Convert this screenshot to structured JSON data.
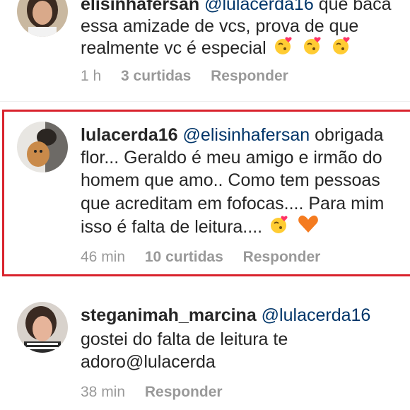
{
  "comments": [
    {
      "username": "elisinhafersan",
      "mention": "@lulacerda16",
      "lines": [
        "que baca",
        "essa amizade de vcs, prova de que",
        "realmente vc é especial"
      ],
      "time": "1 h",
      "likes": "3 curtidas",
      "reply": "Responder",
      "emojis": [
        "kiss-heart-emoji",
        "kiss-heart-emoji",
        "kiss-heart-emoji"
      ]
    },
    {
      "username": "lulacerda16",
      "mention": "@elisinhafersan",
      "lines": [
        "obrigada",
        "flor... Geraldo é meu amigo e irmão do",
        "homem que amo.. Como tem pessoas",
        "que acreditam em fofocas.... Para mim",
        "isso é falta de leitura...."
      ],
      "time": "46 min",
      "likes": "10 curtidas",
      "reply": "Responder",
      "emojis": [
        "kiss-heart-emoji",
        "orange-heart-emoji"
      ]
    },
    {
      "username": "steganimah_marcina",
      "mention": "@lulacerda16",
      "lines": [
        "",
        "gostei do falta de leitura te",
        "adoro@lulacerda"
      ],
      "time": "38 min",
      "reply": "Responder"
    }
  ],
  "colors": {
    "username": "#262626",
    "mention": "#003569",
    "meta": "#999999",
    "highlight": "#d9232d"
  }
}
